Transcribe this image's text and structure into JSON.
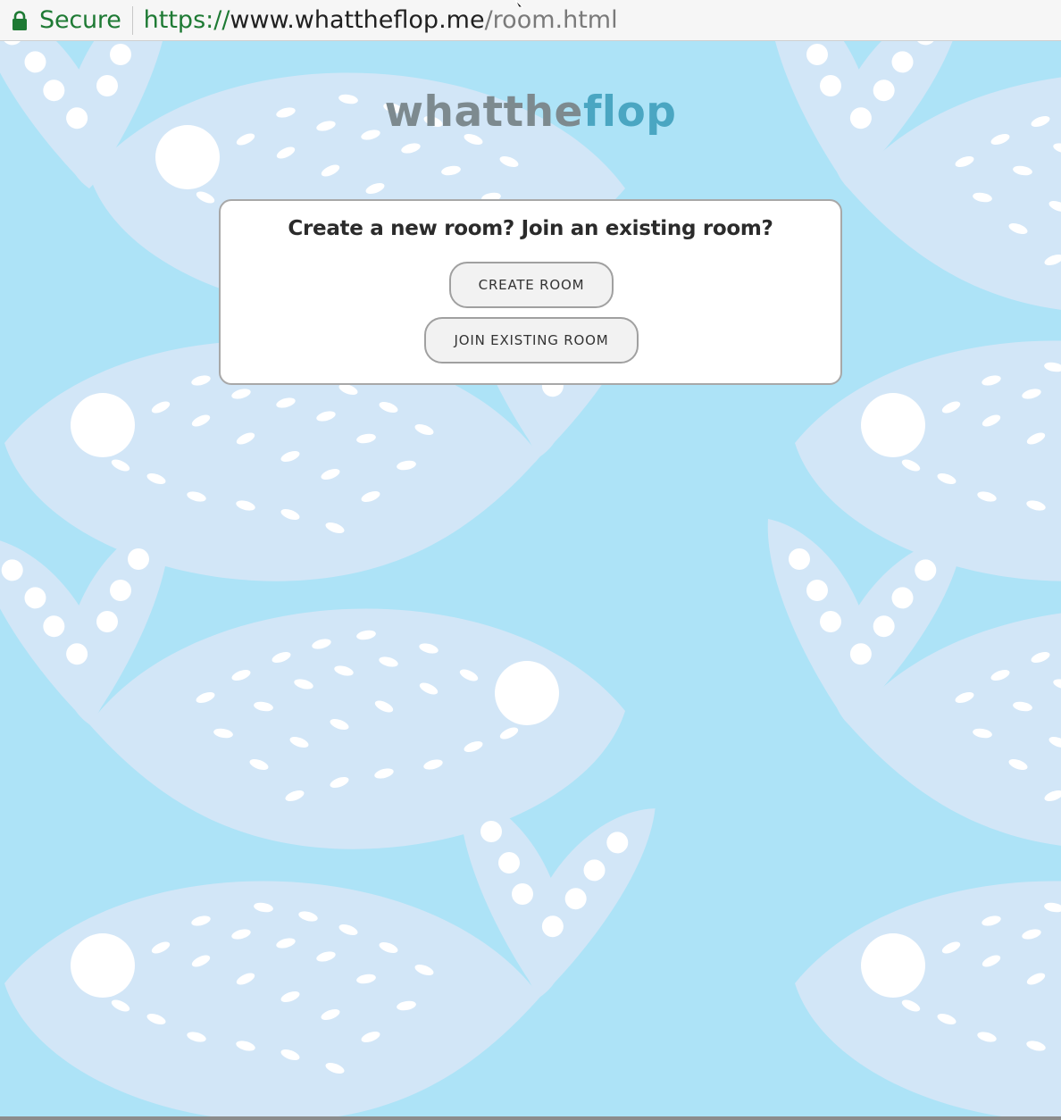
{
  "browser": {
    "security_label": "Secure",
    "url_scheme": "https://",
    "url_host": "www.whattheflop.me",
    "url_path": "/room.html",
    "security_color": "#1e7a34"
  },
  "logo": {
    "part1": "whatthe",
    "part2": "flop"
  },
  "room_prompt": {
    "title": "Create a new room? Join an existing room?",
    "create_label": "CREATE ROOM",
    "join_label": "JOIN EXISTING ROOM"
  },
  "colors": {
    "background": "#ade3f7",
    "fish": "#d2e6f7",
    "logo_grey": "#7d8a8f",
    "logo_teal": "#4aa6c2"
  },
  "icons": [
    "lock-icon",
    "mouse-cursor-icon",
    "fish-pattern"
  ]
}
